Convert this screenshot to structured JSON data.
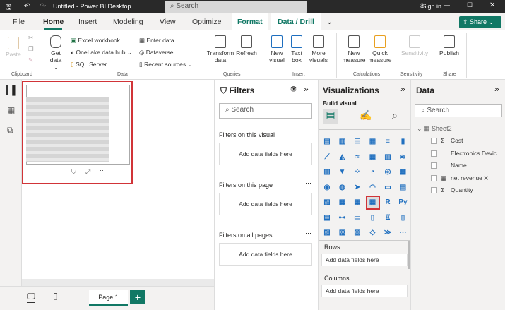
{
  "titlebar": {
    "title": "Untitled - Power BI Desktop",
    "search": "Search",
    "sign_in": "Sign in"
  },
  "tabs": [
    "File",
    "Home",
    "Insert",
    "Modeling",
    "View",
    "Optimize",
    "Format",
    "Data / Drill"
  ],
  "share": "Share",
  "ribbon": {
    "paste": "Paste",
    "get_data": "Get data",
    "excel": "Excel workbook",
    "onelake": "OneLake data hub",
    "sql": "SQL Server",
    "enter_data": "Enter data",
    "dataverse": "Dataverse",
    "recent": "Recent sources",
    "transform": "Transform data",
    "refresh": "Refresh",
    "new_visual": "New visual",
    "text_box": "Text box",
    "more_visuals": "More visuals",
    "new_measure": "New measure",
    "quick_measure": "Quick measure",
    "sensitivity": "Sensitivity",
    "publish": "Publish",
    "groups": [
      "Clipboard",
      "Data",
      "Queries",
      "Insert",
      "Calculations",
      "Sensitivity",
      "Share"
    ]
  },
  "filters": {
    "title": "Filters",
    "search": "Search",
    "sections": [
      {
        "label": "Filters on this visual",
        "drop": "Add data fields here"
      },
      {
        "label": "Filters on this page",
        "drop": "Add data fields here"
      },
      {
        "label": "Filters on all pages",
        "drop": "Add data fields here"
      }
    ]
  },
  "viz": {
    "title": "Visualizations",
    "build": "Build visual",
    "icons": [
      "▤",
      "▥",
      "☰",
      "▦",
      "≡",
      "▮",
      "⟋",
      "◭",
      "≈",
      "▦",
      "▥",
      "≋",
      "▥",
      "▼",
      "⁘",
      "◔",
      "◎",
      "▦",
      "◉",
      "◍",
      "➤",
      "◠",
      "▭",
      "▤",
      "▨",
      "▦",
      "▦",
      "▦",
      "R",
      "Py",
      "▤",
      "⊶",
      "▭",
      "▯",
      "♖",
      "▯",
      "▨",
      "▨",
      "▨",
      "◇",
      "≫",
      "⋯"
    ],
    "rows": "Rows",
    "rows_drop": "Add data fields here",
    "columns": "Columns",
    "columns_drop": "Add data fields here"
  },
  "data": {
    "title": "Data",
    "search": "Search",
    "table": "Sheet2",
    "fields": [
      {
        "icon": "Σ",
        "name": "Cost"
      },
      {
        "icon": "",
        "name": "Electronics Devic..."
      },
      {
        "icon": "",
        "name": "Name"
      },
      {
        "icon": "▦",
        "name": "net revenue X"
      },
      {
        "icon": "Σ",
        "name": "Quantity"
      }
    ]
  },
  "bottom": {
    "page": "Page 1",
    "add": "+"
  },
  "accent": "#117865",
  "highlight": "#d13438"
}
